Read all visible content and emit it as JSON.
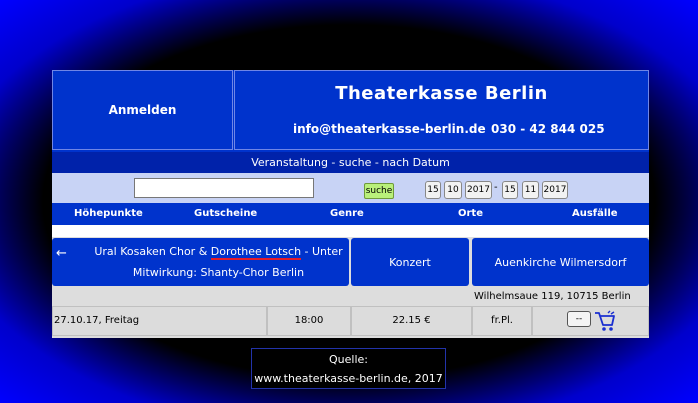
{
  "header": {
    "login_label": "Anmelden",
    "title": "Theaterkasse Berlin",
    "email": "info@theaterkasse-berlin.de",
    "phone": "030 - 42 844 025"
  },
  "subheader": "Veranstaltung - suche - nach Datum",
  "search": {
    "value": "",
    "button_label": "suche",
    "from": {
      "day": "15",
      "month": "10",
      "year": "2017"
    },
    "separator": "-",
    "to": {
      "day": "15",
      "month": "11",
      "year": "2017"
    }
  },
  "nav": {
    "items": [
      "Höhepunkte",
      "Gutscheine",
      "Genre",
      "Orte",
      "Ausfälle"
    ]
  },
  "event": {
    "arrow": "←",
    "title_part1": "Ural Kosaken Chor & ",
    "title_link": "Dorothee Lotsch",
    "title_part2": " - Unter",
    "title_line2": "Mitwirkung: Shanty-Chor Berlin",
    "genre": "Konzert",
    "venue": "Auenkirche Wilmersdorf",
    "address": "Wilhelmsaue 119, 10715 Berlin"
  },
  "performance": {
    "date": "27.10.17, Freitag",
    "time": "18:00",
    "price": "22.15 €",
    "seating": "fr.Pl.",
    "more_label": "--"
  },
  "caption": {
    "line1": "Quelle:",
    "line2": "www.theaterkasse-berlin.de, 2017"
  },
  "colors": {
    "brand_blue": "#0033cc",
    "search_bar": "#c8d3f5",
    "button_green": "#b9f07a",
    "link_underline": "#e21b2a"
  },
  "icons": [
    "back-arrow-icon",
    "shopping-cart-icon"
  ]
}
